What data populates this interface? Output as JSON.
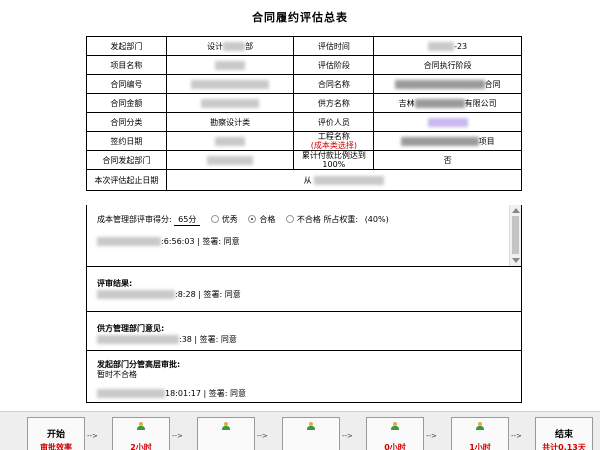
{
  "form": {
    "title": "合同履约评估总表"
  },
  "rows": [
    {
      "l1": "发起部门",
      "v1": "设计",
      "v1b": "部",
      "l2": "评估时间",
      "v2": "-23"
    },
    {
      "l1": "项目名称",
      "v1": "",
      "l2": "评估阶段",
      "v2": "合同执行阶段"
    },
    {
      "l1": "合同编号",
      "v1": "",
      "l2": "合同名称",
      "v2": "合同"
    },
    {
      "l1": "合同金额",
      "v1": "",
      "l2": "供方名称",
      "v2a": "吉林",
      "v2": "有限公司"
    },
    {
      "l1": "合同分类",
      "v1": "勘察设计类",
      "l2": "评价人员",
      "v2": ""
    },
    {
      "l1": "签约日期",
      "v1": "",
      "l2": "工程名称",
      "l2sub": "(成本类选择)",
      "v2": "项目"
    },
    {
      "l1": "合同发起部门",
      "v1": "",
      "l2": "累计付款比例达到100%",
      "v2": "否"
    },
    {
      "l1": "本次评估起止日期",
      "span": "从"
    }
  ],
  "score": {
    "label": "成本管理部评审得分:",
    "value": "65分",
    "options": [
      "优秀",
      "合格",
      "不合格"
    ],
    "selected": "合格",
    "weight_label": "所占权重:",
    "weight": "(40%)",
    "sign_time": ":6:56:03",
    "sign_text": "| 签署: 同意"
  },
  "review": {
    "title": "评审结果:",
    "time": ":8:28",
    "sign_text": "| 签署: 同意"
  },
  "supplier": {
    "title": "供方管理部门意见:",
    "time": ":38",
    "sign_text": "| 签署: 同意"
  },
  "exec": {
    "title": "发起部门分管高层审批:",
    "note": "暂时不合格",
    "time": "18:01:17",
    "sign_text": "| 签署: 同意"
  },
  "flow": {
    "start": {
      "title": "开始",
      "sub": "审批效率"
    },
    "steps": [
      "2小时",
      "",
      "",
      "0小时",
      "1小时"
    ],
    "end": {
      "title": "结束",
      "sub": "共计0.13天"
    },
    "arrow": "-->"
  }
}
